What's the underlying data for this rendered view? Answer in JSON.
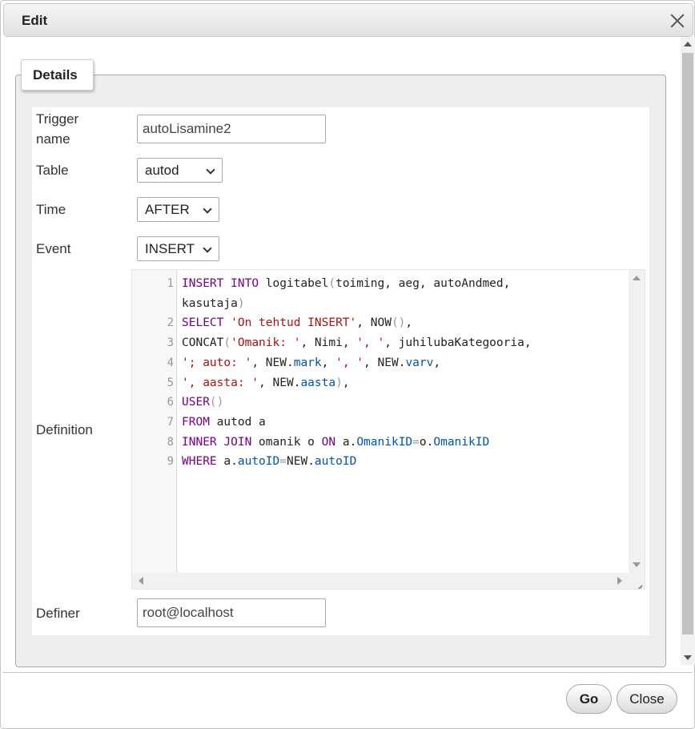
{
  "dialog": {
    "title": "Edit"
  },
  "fieldset": {
    "legend": "Details"
  },
  "form": {
    "trigger_name_label_line1": "Trigger",
    "trigger_name_label_line2": "name",
    "trigger_name_value": "autoLisamine2",
    "table_label": "Table",
    "table_value": "autod",
    "time_label": "Time",
    "time_value": "AFTER",
    "event_label": "Event",
    "event_value": "INSERT",
    "definition_label": "Definition",
    "definer_label": "Definer",
    "definer_value": "root@localhost"
  },
  "editor": {
    "line_numbers": [
      "1",
      "2",
      "3",
      "4",
      "5",
      "6",
      "7",
      "8",
      "9"
    ],
    "lines": [
      "INSERT INTO logitabel(toiming, aeg, autoAndmed,",
      "kasutaja)",
      "SELECT 'On tehtud INSERT', NOW(),",
      "CONCAT('Omanik: ', Nimi, ', ', juhilubaKategooria,",
      "'; auto: ', NEW.mark, ', ', NEW.varv,",
      "', aasta: ', NEW.aasta),",
      "USER()",
      "FROM autod a",
      "INNER JOIN omanik o ON a.OmanikID=o.OmanikID",
      "WHERE a.autoID=NEW.autoID"
    ]
  },
  "buttons": {
    "go": "Go",
    "close": "Close"
  }
}
